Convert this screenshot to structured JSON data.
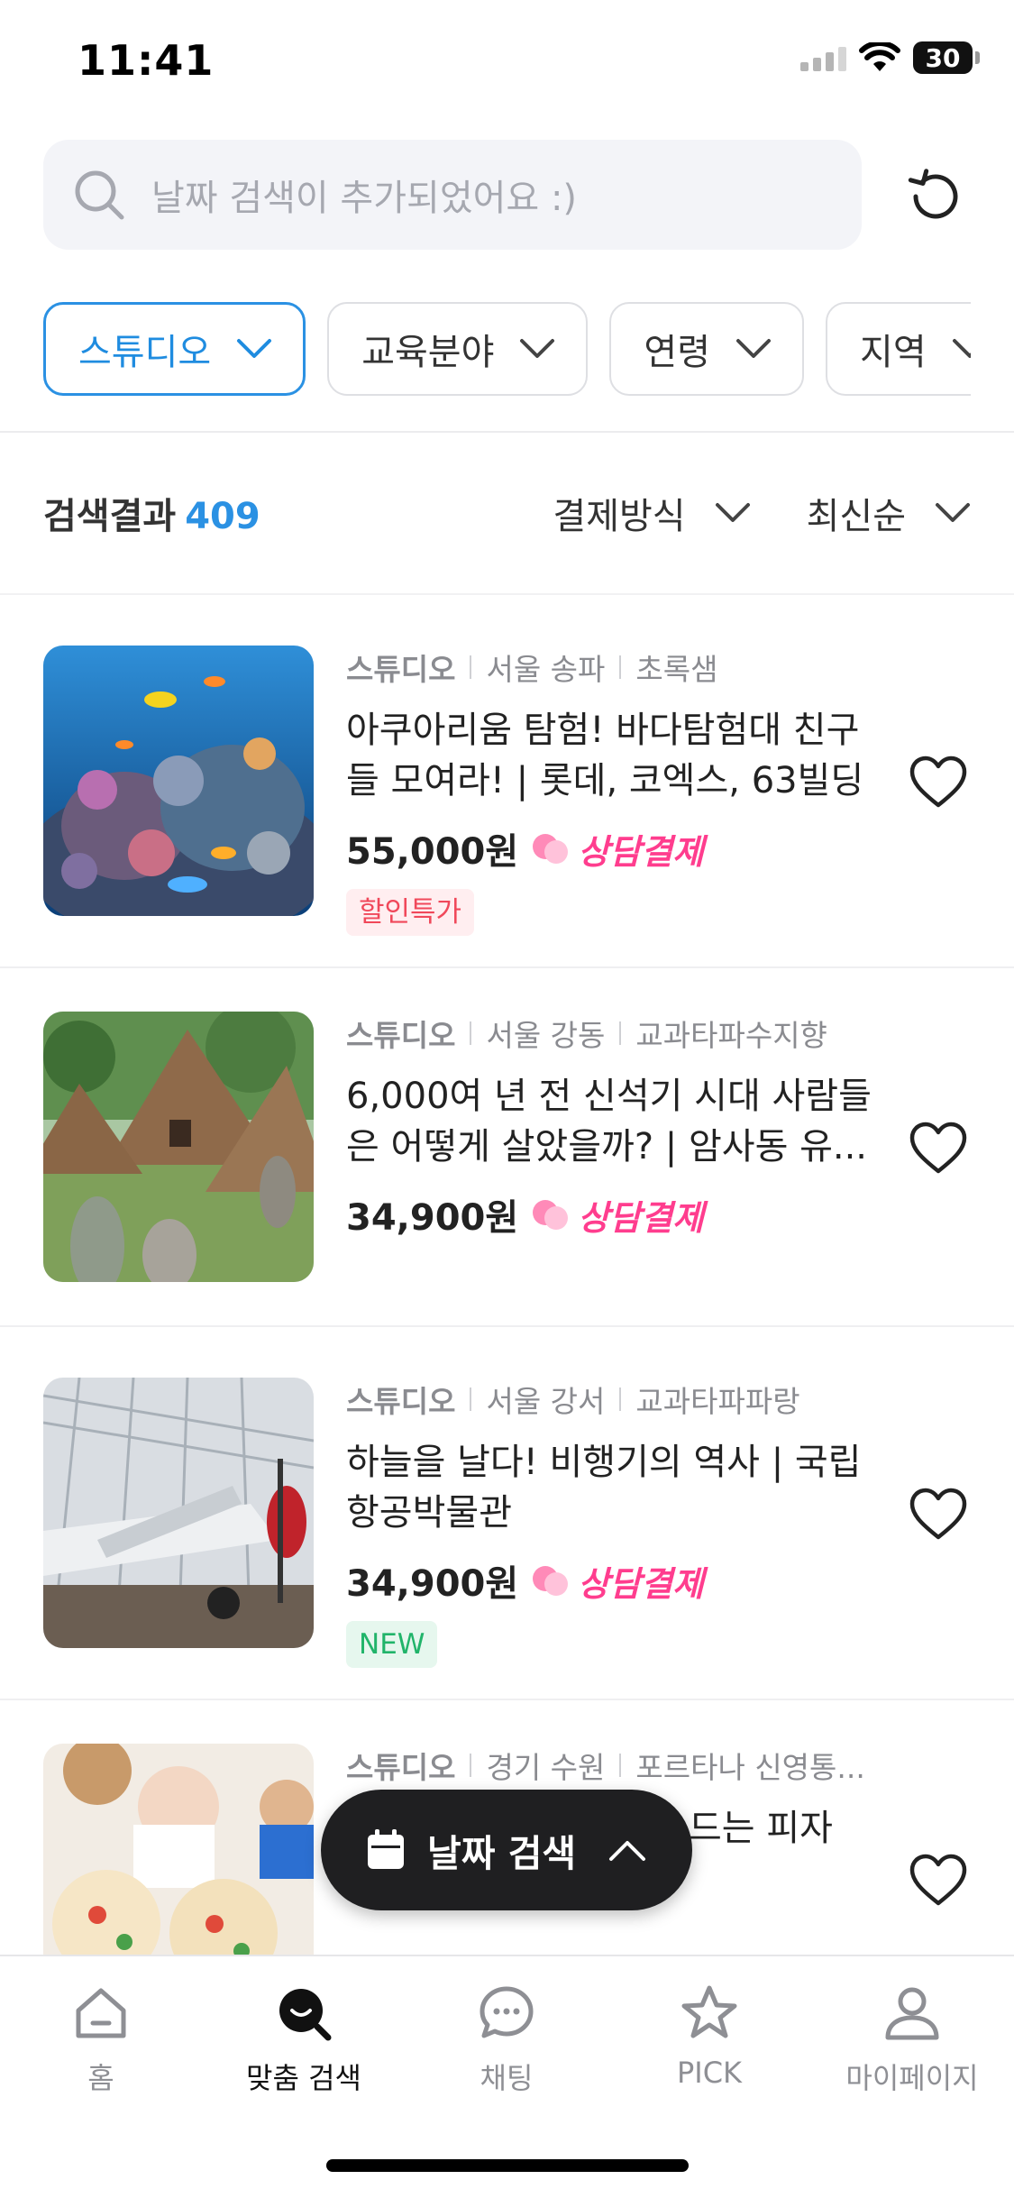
{
  "status_bar": {
    "time": "11:41",
    "battery": "30"
  },
  "search": {
    "placeholder": "날짜 검색이 추가되었어요 :)"
  },
  "filters": [
    {
      "label": "스튜디오",
      "active": true
    },
    {
      "label": "교육분야",
      "active": false
    },
    {
      "label": "연령",
      "active": false
    },
    {
      "label": "지역",
      "active": false
    }
  ],
  "results": {
    "label": "검색결과",
    "count": "409"
  },
  "sort": {
    "payment_label": "결제방식",
    "order_label": "최신순"
  },
  "listings": [
    {
      "type": "스튜디오",
      "region": "서울 송파",
      "provider": "초록샘",
      "title": "아쿠아리움 탐험! 바다탐험대 친구들 모여라! | 롯데, 코엑스, 63빌딩",
      "price": "55,000원",
      "payment": "상담결제",
      "badge": "할인특가",
      "badge_kind": "sale",
      "image": "aquarium-coral-photo"
    },
    {
      "type": "스튜디오",
      "region": "서울 강동",
      "provider": "교과타파수지향",
      "title": "6,000여 년 전 신석기 시대 사람들은 어떻게 살았을까? | 암사동 유...",
      "price": "34,900원",
      "payment": "상담결제",
      "badge": "",
      "badge_kind": "",
      "image": "neolithic-huts-photo"
    },
    {
      "type": "스튜디오",
      "region": "서울 강서",
      "provider": "교과타파파랑",
      "title": "하늘을 날다! 비행기의 역사 | 국립항공박물관",
      "price": "34,900원",
      "payment": "상담결제",
      "badge": "NEW",
      "badge_kind": "new",
      "image": "aviation-museum-photo"
    },
    {
      "type": "스튜디오",
      "region": "경기 수원",
      "provider": "포르타나 신영통...",
      "title": "드는 피자",
      "price": "",
      "payment": "",
      "badge": "",
      "badge_kind": "",
      "image": "kids-making-pizza-photo"
    }
  ],
  "floating_button": {
    "label": "날짜 검색",
    "icon": "calendar-icon"
  },
  "bottom_nav": [
    {
      "label": "홈",
      "icon": "home-icon",
      "active": false
    },
    {
      "label": "맞춤 검색",
      "icon": "custom-search-icon",
      "active": true
    },
    {
      "label": "채팅",
      "icon": "chat-icon",
      "active": false
    },
    {
      "label": "PICK",
      "icon": "star-icon",
      "active": false
    },
    {
      "label": "마이페이지",
      "icon": "person-icon",
      "active": false
    }
  ],
  "colors": {
    "accent": "#2b91e3",
    "pink": "#ff3d8e",
    "sale": "#f0485a",
    "new": "#21b46a"
  }
}
